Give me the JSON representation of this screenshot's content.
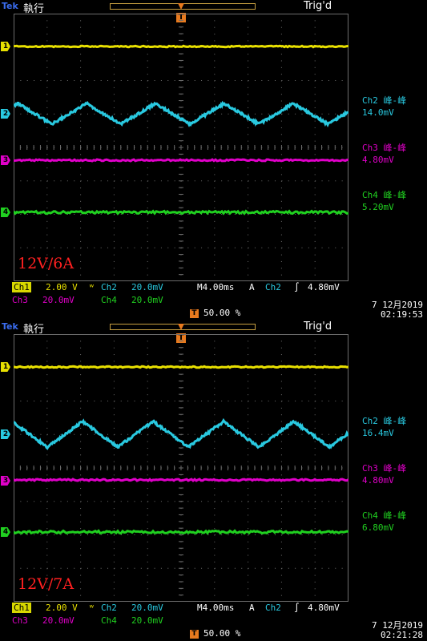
{
  "screens": [
    {
      "tek": "Tek",
      "run_state": "執行",
      "trig_state": "Trig'd",
      "trig_marker": "T",
      "channel_markers": [
        "1",
        "2",
        "3",
        "4"
      ],
      "measurements": [
        {
          "title": "Ch2 峰-峰",
          "value": "14.0mV",
          "color": "#29c9e0"
        },
        {
          "title": "Ch3 峰-峰",
          "value": "4.80mV",
          "color": "#e000c8"
        },
        {
          "title": "Ch4 峰-峰",
          "value": "5.20mV",
          "color": "#20d020"
        }
      ],
      "label": "12V/6A",
      "status": {
        "ch1_name": "Ch1",
        "ch1_scale": "2.00 V",
        "ch2_name": "Ch2",
        "ch2_scale": "20.0mV",
        "timebase": "M4.00ms",
        "trig_src_prefix": "A",
        "trig_src": "Ch2",
        "trig_edge": "∫",
        "trig_level": "4.80mV",
        "ch3_name": "Ch3",
        "ch3_scale": "20.0mV",
        "ch4_name": "Ch4",
        "ch4_scale": "20.0mV",
        "bw": "ʷ",
        "trig_pos_marker": "T",
        "trig_pos": "50.00 %",
        "date": "7 12月2019",
        "time": "02:19:53"
      }
    },
    {
      "tek": "Tek",
      "run_state": "執行",
      "trig_state": "Trig'd",
      "trig_marker": "T",
      "channel_markers": [
        "1",
        "2",
        "3",
        "4"
      ],
      "measurements": [
        {
          "title": "Ch2 峰-峰",
          "value": "16.4mV",
          "color": "#29c9e0"
        },
        {
          "title": "Ch3 峰-峰",
          "value": "4.80mV",
          "color": "#e000c8"
        },
        {
          "title": "Ch4 峰-峰",
          "value": "6.80mV",
          "color": "#20d020"
        }
      ],
      "label": "12V/7A",
      "status": {
        "ch1_name": "Ch1",
        "ch1_scale": "2.00 V",
        "ch2_name": "Ch2",
        "ch2_scale": "20.0mV",
        "timebase": "M4.00ms",
        "trig_src_prefix": "A",
        "trig_src": "Ch2",
        "trig_edge": "∫",
        "trig_level": "4.80mV",
        "ch3_name": "Ch3",
        "ch3_scale": "20.0mV",
        "ch4_name": "Ch4",
        "ch4_scale": "20.0mV",
        "bw": "ʷ",
        "trig_pos_marker": "T",
        "trig_pos": "50.00 %",
        "date": "7 12月2019",
        "time": "02:21:28"
      }
    }
  ],
  "colors": {
    "ch1": "#e8e000",
    "ch2": "#29c9e0",
    "ch3": "#e000c8",
    "ch4": "#20d020",
    "grid": "#6c6c6c",
    "trig": "#e87a1e"
  }
}
